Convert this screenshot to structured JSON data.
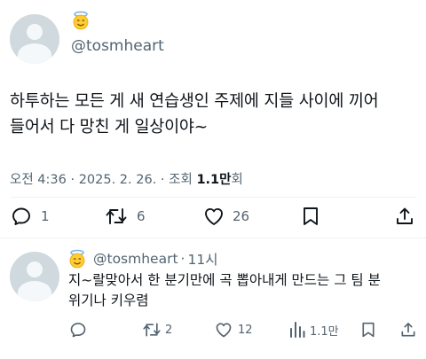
{
  "tweet": {
    "handle": "@tosmheart",
    "text_line1": "하투하는 모든 게 새 연습생인 주제에 지들 사이에 끼어",
    "text_line2": "들어서 다 망친 게 일상이야~",
    "time": "오전 4:36",
    "dot": "·",
    "date": "2025. 2. 26.",
    "views_prefix": "조회",
    "views_count": "1.1만",
    "views_suffix": "회",
    "replies": "1",
    "retweets": "6",
    "likes": "26"
  },
  "reply": {
    "handle": "@tosmheart",
    "dot": "·",
    "time": "11시",
    "text_line1": "지~랄맞아서 한 분기만에 곡 뽑아내게 만드는 그 팀 분",
    "text_line2": "위기나 키우렴",
    "retweets": "2",
    "likes": "12",
    "views": "1.1만"
  },
  "icons": {
    "badge": "halo-smiley-icon",
    "accent": "#536471"
  }
}
